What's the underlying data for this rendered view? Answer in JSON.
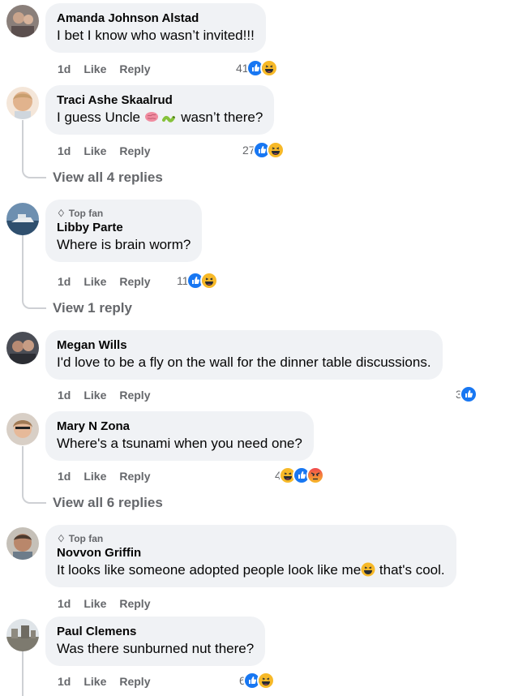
{
  "actions": {
    "like": "Like",
    "reply": "Reply"
  },
  "badge_top_fan": "Top fan",
  "comments": [
    {
      "author": "Amanda Johnson Alstad",
      "text": "I bet I know who wasn’t invited!!!",
      "time": "1d",
      "count": "41"
    },
    {
      "author": "Traci Ashe Skaalrud",
      "text_a": "I guess Uncle",
      "text_b": "wasn’t there?",
      "time": "1d",
      "count": "27",
      "view_replies": "View all 4 replies"
    },
    {
      "author": "Libby Parte",
      "text": "Where is brain worm?",
      "time": "1d",
      "count": "11",
      "view_replies": "View 1 reply"
    },
    {
      "author": "Megan Wills",
      "text": "I'd love to be a fly on the wall for the dinner table discussions.",
      "time": "1d",
      "count": "3"
    },
    {
      "author": "Mary N Zona",
      "text": "Where's a tsunami when you need one?",
      "time": "1d",
      "count": "4",
      "view_replies": "View all 6 replies"
    },
    {
      "author": "Novvon Griffin",
      "text_a": "It looks like someone adopted people look like me",
      "text_b": "that's cool.",
      "time": "1d"
    },
    {
      "author": "Paul Clemens",
      "text": "Was there sunburned nut there?",
      "time": "1d",
      "count": "6"
    }
  ],
  "colors": {
    "like_blue": "#1877f2",
    "haha_yellow": "#f7b928",
    "angry_red": "#e9710f",
    "bubble_bg": "#f0f2f5",
    "muted": "#65676b"
  }
}
